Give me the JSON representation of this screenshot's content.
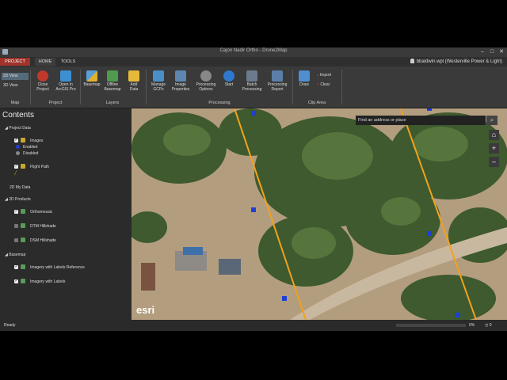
{
  "window": {
    "title": "Cajon Nadir Ortho - Drone2Map",
    "controls": [
      "–",
      "□",
      "✕"
    ]
  },
  "tabs": [
    {
      "label": "PROJECT",
      "active": false
    },
    {
      "label": "HOME",
      "active": true
    },
    {
      "label": "TOOLS",
      "active": false
    }
  ],
  "user": "bbaldwin.wpl (Westerville Power & Light)",
  "ribbon": {
    "view2d": "2D View",
    "view3d": "3D View",
    "buttons": {
      "close_project": "Close\nProject",
      "open_arcgis": "Open in\nArcGIS Pro",
      "basemap": "Basemap",
      "offline_basemap": "Offline\nBasemap",
      "add_data": "Add\nData",
      "manage_gcps": "Manage\nGCPs",
      "image_properties": "Image\nProperties",
      "processing_options": "Processing\nOptions",
      "start": "Start",
      "batch_processing": "Batch\nProcessing",
      "processing_report": "Processing\nReport",
      "draw": "Draw",
      "import": "Import",
      "clear": "Clear"
    },
    "groups": {
      "map": "Map",
      "project": "Project",
      "layers": "Layers",
      "processing": "Processing",
      "clip_area": "Clip Area"
    }
  },
  "contents": {
    "title": "Contents",
    "project_data": "Project Data",
    "images": "Images",
    "enabled": "Enabled",
    "disabled": "Disabled",
    "flight_path": "Flight Path",
    "my_data_2d": "2D My Data",
    "products_2d": "2D Products",
    "orthomosaic": "Orthomosaic",
    "dtm_hillshade": "DTM Hillshade",
    "dsm_hillshade": "DSM Hillshade",
    "basemap": "Basemap",
    "imagery_labels_ref": "Imagery with Labels Reference",
    "imagery_labels": "Imagery with Labels"
  },
  "map": {
    "search_placeholder": "Find an address or place",
    "attribution": "esri",
    "home_icon": "⌂",
    "zoom_in": "+",
    "zoom_out": "–",
    "search_icon": "⌕"
  },
  "status": {
    "text": "Ready",
    "progress": "0%",
    "count": "0"
  },
  "colors": {
    "project_tab": "#a0332b",
    "flight_line": "#f2a21b",
    "image_point_enabled": "#1f3fd6"
  }
}
